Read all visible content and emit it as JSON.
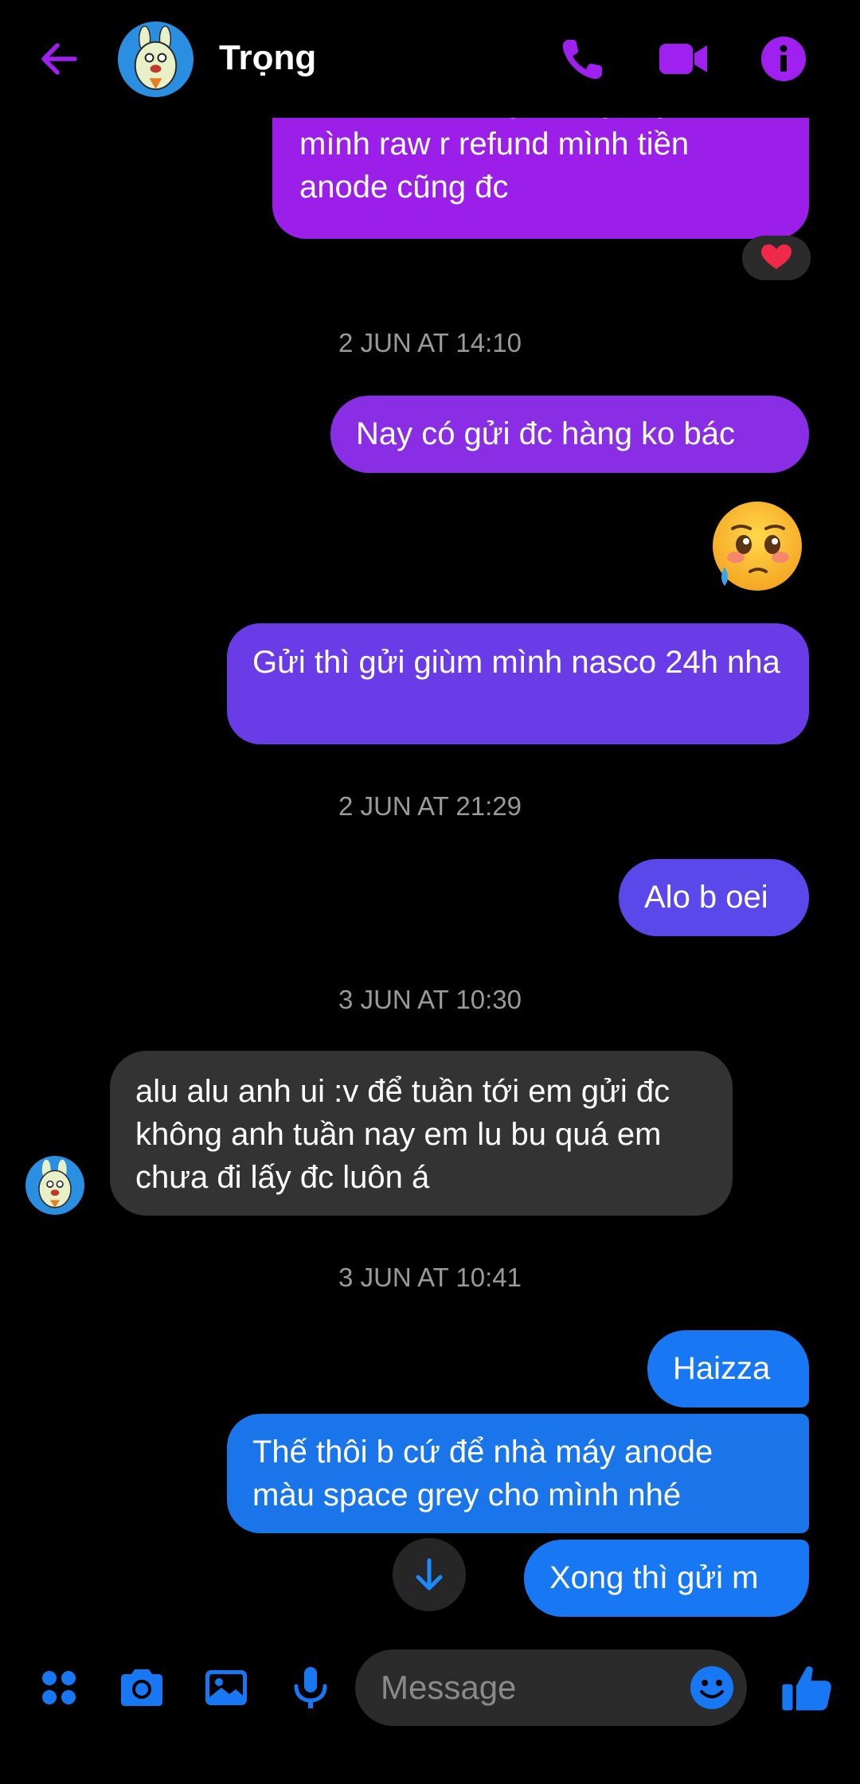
{
  "header": {
    "contact_name": "Trọng",
    "icons": [
      "back-arrow-icon",
      "phone-icon",
      "video-camera-icon",
      "info-icon"
    ]
  },
  "messages": [
    {
      "type": "sent",
      "text": "mai nhờ bác lấy về r gửi giùm mình raw r refund mình tiền anode cũng đc",
      "color": "#9b1fe8",
      "reaction": "heart"
    },
    {
      "type": "timestamp",
      "text": "2 JUN AT 14:10"
    },
    {
      "type": "sent",
      "text": "Nay có gửi đc hàng ko bác",
      "color": "#8a2ee6"
    },
    {
      "type": "emoji",
      "name": "pleading-face-emoji"
    },
    {
      "type": "sent",
      "text": "Gửi thì gửi giùm mình nasco 24h nha",
      "color": "#6a3ce8"
    },
    {
      "type": "timestamp",
      "text": "2 JUN AT 21:29"
    },
    {
      "type": "sent",
      "text": "Alo b oei",
      "color": "#5a48ea"
    },
    {
      "type": "timestamp",
      "text": "3 JUN AT 10:30"
    },
    {
      "type": "received",
      "text": "alu alu anh ui :v để tuần tới em gửi đc không anh tuần nay em lu bu quá em chưa đi lấy đc luôn á",
      "color": "#333333"
    },
    {
      "type": "timestamp",
      "text": "3 JUN AT 10:41"
    },
    {
      "type": "sent",
      "text": "Haizza",
      "color": "#1877f2"
    },
    {
      "type": "sent",
      "text": "Thế thôi b cứ để nhà máy anode màu space grey cho mình nhé",
      "color": "#1a74ea"
    },
    {
      "type": "sent",
      "text": "Xong thì gửi m",
      "color": "#1877f2"
    }
  ],
  "composer": {
    "placeholder": "Message",
    "icons": [
      "menu-dots-icon",
      "camera-icon",
      "gallery-icon",
      "microphone-icon",
      "emoji-icon",
      "thumbs-up-icon"
    ],
    "accent": "#1877f2"
  },
  "colors": {
    "header_accent": "#a020f0",
    "background": "#000000"
  }
}
